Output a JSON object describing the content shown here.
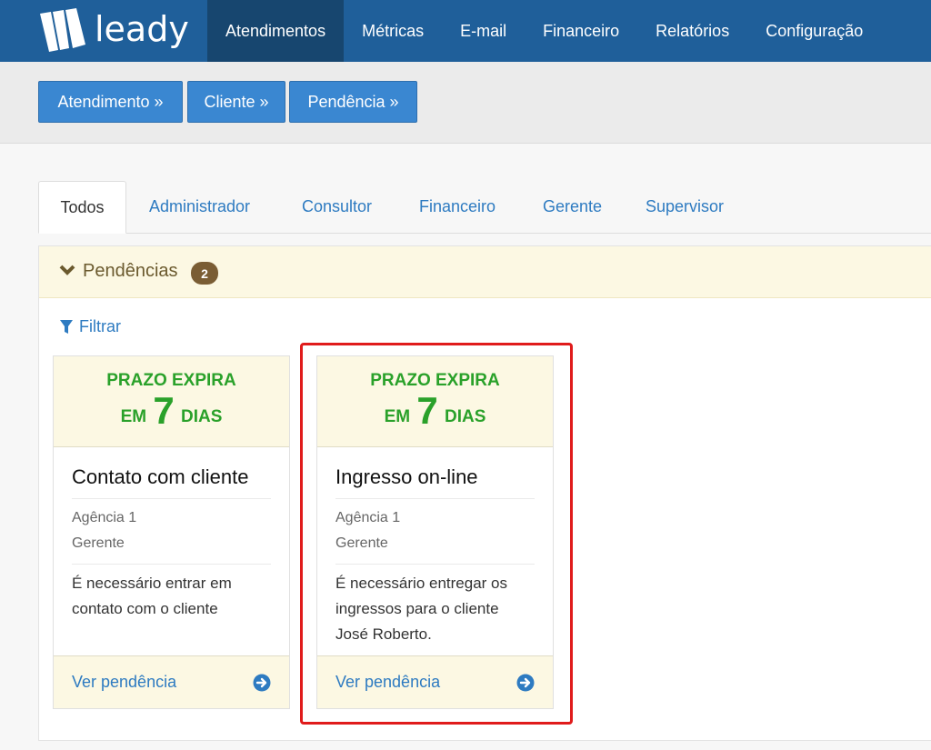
{
  "brand": {
    "name": "leady",
    "logo_icon": "leady-logo-icon"
  },
  "nav": {
    "items": [
      {
        "label": "Atendimentos",
        "active": true
      },
      {
        "label": "Métricas",
        "active": false
      },
      {
        "label": "E-mail",
        "active": false
      },
      {
        "label": "Financeiro",
        "active": false
      },
      {
        "label": "Relatórios",
        "active": false
      },
      {
        "label": "Configuração",
        "active": false
      }
    ]
  },
  "actions": {
    "atendimento": "Atendimento »",
    "cliente": "Cliente »",
    "pendencia": "Pendência »"
  },
  "tabs": [
    {
      "label": "Todos",
      "active": true
    },
    {
      "label": "Administrador"
    },
    {
      "label": "Consultor"
    },
    {
      "label": "Financeiro"
    },
    {
      "label": "Gerente"
    },
    {
      "label": "Supervisor"
    }
  ],
  "panel": {
    "title": "Pendências",
    "count": "2",
    "filter_label": "Filtrar"
  },
  "cards": [
    {
      "deadline_line1": "PRAZO EXPIRA",
      "deadline_prefix": "EM",
      "deadline_number": "7",
      "deadline_suffix": "DIAS",
      "title": "Contato com cliente",
      "agency": "Agência 1",
      "role": "Gerente",
      "description": "É necessário entrar em contato com o cliente",
      "link": "Ver pendência"
    },
    {
      "deadline_line1": "PRAZO EXPIRA",
      "deadline_prefix": "EM",
      "deadline_number": "7",
      "deadline_suffix": "DIAS",
      "title": "Ingresso on-line",
      "agency": "Agência 1",
      "role": "Gerente",
      "description": "É necessário entregar os ingressos para o cliente José Roberto.",
      "link": "Ver pendência"
    }
  ],
  "colors": {
    "nav_bg": "#1f5f9a",
    "nav_active": "#17466f",
    "button": "#3a87d1",
    "deadline_green": "#2aa12a",
    "link_blue": "#2e7bc1",
    "highlight_red": "#e01b1b"
  }
}
